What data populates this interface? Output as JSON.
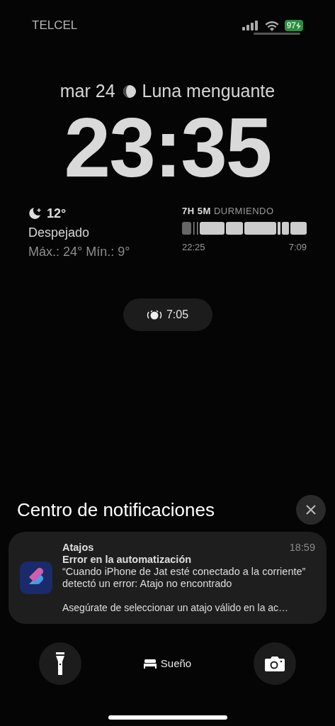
{
  "status_bar": {
    "carrier": "TELCEL",
    "battery": "97"
  },
  "lock": {
    "date": "mar 24",
    "moon": "Luna menguante",
    "time": "23:35"
  },
  "weather": {
    "temp": "12°",
    "condition": "Despejado",
    "range": "Máx.: 24° Mín.: 9°"
  },
  "sleep": {
    "duration": "7H 5M",
    "label": "DURMIENDO",
    "start": "22:25",
    "end": "7:09"
  },
  "alarm": {
    "time": "7:05"
  },
  "notification_center": {
    "title": "Centro de notificaciones",
    "notifications": [
      {
        "app": "Atajos",
        "time": "18:59",
        "title": "Error en la automatización",
        "body": "“Cuando iPhone de Jat esté conectado a la corriente” detectó un error: Atajo no encontrado",
        "extra": "Asegúrate de seleccionar un atajo válido en la ac…"
      }
    ]
  },
  "focus": {
    "label": "Sueño"
  }
}
